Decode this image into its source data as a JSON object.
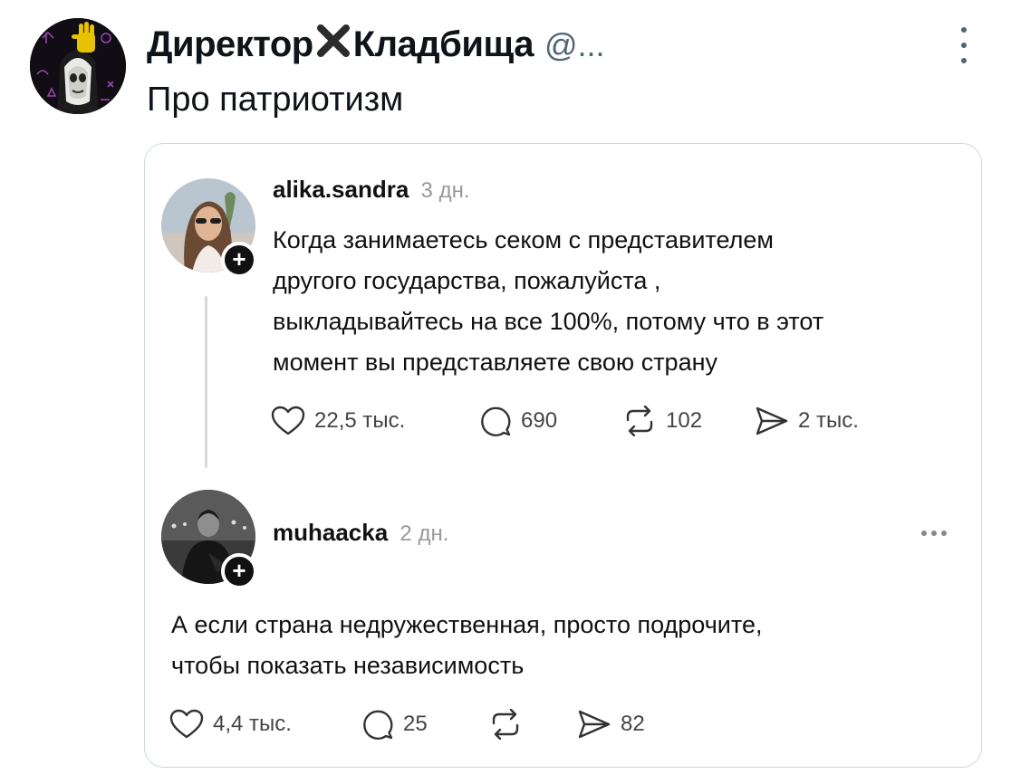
{
  "tweet": {
    "author_name_left": "Директор",
    "author_name_right": "Кладбища",
    "author_handle": "@...",
    "text": "Про патриотизм"
  },
  "quote": {
    "post1": {
      "username": "alika.sandra",
      "time": "3 дн.",
      "text_lines": [
        "Когда занимаетесь секом с представителем",
        "другого государства, пожалуйста ,",
        "выкладывайтесь на все 100%, потому что в этот",
        "момент вы представляете свою страну"
      ],
      "likes": "22,5 тыс.",
      "comments": "690",
      "reposts": "102",
      "shares": "2 тыс."
    },
    "post2": {
      "username": "muhaacka",
      "time": "2 дн.",
      "text_lines": [
        "А если страна недружественная, просто подрочите,",
        "чтобы показать независимость"
      ],
      "likes": "4,4 тыс.",
      "comments": "25",
      "shares": "82"
    },
    "follow_badge": "+"
  },
  "icons": {
    "more": "more-vertical-icon",
    "like": "heart-icon",
    "comment": "comment-bubble-icon",
    "repost": "repost-icon",
    "share": "send-icon",
    "cross": "red-cross-icon"
  },
  "colors": {
    "text": "#0f1419",
    "secondary": "#536471",
    "card_border": "#cfd9de",
    "cross": "#2b2b2b"
  }
}
